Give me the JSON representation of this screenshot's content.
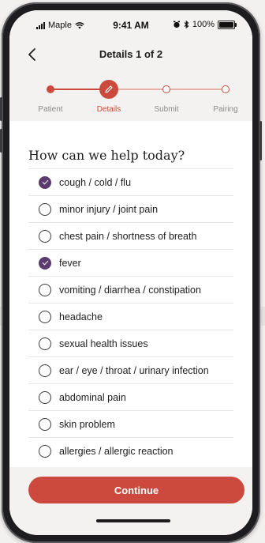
{
  "status_bar": {
    "carrier": "Maple",
    "time": "9:41 AM",
    "battery": "100%"
  },
  "header": {
    "title": "Details 1 of 2"
  },
  "stepper": {
    "steps": [
      {
        "label": "Patient",
        "state": "done"
      },
      {
        "label": "Details",
        "state": "current"
      },
      {
        "label": "Submit",
        "state": "todo"
      },
      {
        "label": "Pairing",
        "state": "todo"
      }
    ]
  },
  "main": {
    "question": "How can we help today?",
    "options": [
      {
        "label": "cough / cold / flu",
        "checked": true
      },
      {
        "label": "minor injury / joint pain",
        "checked": false
      },
      {
        "label": "chest pain / shortness of breath",
        "checked": false
      },
      {
        "label": "fever",
        "checked": true
      },
      {
        "label": "vomiting / diarrhea / constipation",
        "checked": false
      },
      {
        "label": "headache",
        "checked": false
      },
      {
        "label": "sexual health issues",
        "checked": false
      },
      {
        "label": "ear / eye / throat / urinary infection",
        "checked": false
      },
      {
        "label": "abdominal pain",
        "checked": false
      },
      {
        "label": "skin problem",
        "checked": false
      },
      {
        "label": "allergies / allergic reaction",
        "checked": false
      }
    ]
  },
  "footer": {
    "continue_label": "Continue"
  },
  "colors": {
    "accent": "#cc4a3d",
    "checked": "#5b3b6e"
  }
}
